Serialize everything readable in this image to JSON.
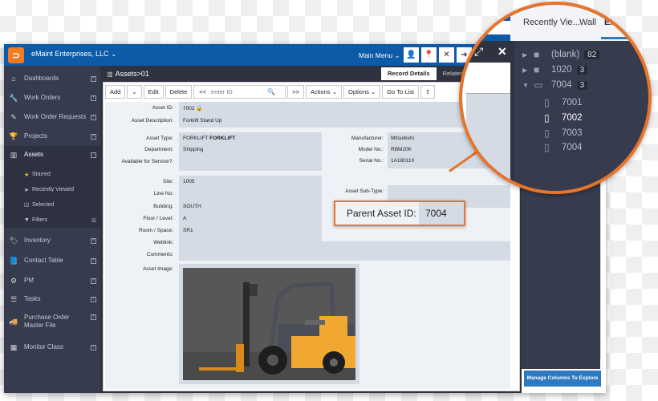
{
  "app": {
    "company": "eMaint Enterprises, LLC",
    "main_menu": "Main Menu",
    "toolbar_icons": [
      "user-icon",
      "pin-icon",
      "close-x-icon",
      "logout-icon"
    ]
  },
  "sidebar": {
    "items": [
      {
        "label": "Dashboards",
        "icon": "home-icon"
      },
      {
        "label": "Work Orders",
        "icon": "wrench-icon"
      },
      {
        "label": "Work Order Requests",
        "icon": "edit-icon"
      },
      {
        "label": "Projects",
        "icon": "trophy-icon"
      },
      {
        "label": "Assets",
        "icon": "barcode-icon"
      },
      {
        "label": "Inventory",
        "icon": "tag-icon"
      },
      {
        "label": "Contact Table",
        "icon": "book-icon"
      },
      {
        "label": "PM",
        "icon": "gears-icon"
      },
      {
        "label": "Tasks",
        "icon": "tasks-icon"
      },
      {
        "label": "Purchase Order Master File",
        "icon": "truck-icon"
      },
      {
        "label": "Monitor Class",
        "icon": "calendar-icon"
      }
    ],
    "asset_subitems": [
      {
        "label": "Starred",
        "icon": "star-icon"
      },
      {
        "label": "Recently Viewed",
        "icon": "location-arrow-icon"
      },
      {
        "label": "Selected",
        "icon": "checkbox-icon"
      },
      {
        "label": "Filters",
        "icon": "filter-icon"
      }
    ]
  },
  "content": {
    "breadcrumb": "Assets>01",
    "tabs": [
      "Record Details",
      "Related Ta"
    ],
    "toolbar": {
      "add": "Add",
      "edit": "Edit",
      "delete": "Delete",
      "prev": "<<",
      "search_placeholder": "enter ID",
      "next": ">>",
      "actions": "Actions",
      "options": "Options",
      "go_to_list": "Go To List"
    },
    "fields": {
      "asset_id_label": "Asset ID:",
      "asset_id": "7002",
      "asset_description_label": "Asset Description:",
      "asset_description": "Forklift Stand Up",
      "asset_type_label": "Asset Type:",
      "asset_type_code": "FORKLIFT",
      "asset_type_name": "FORKLIFT",
      "department_label": "Department:",
      "department": "Shipping",
      "available_label": "Available for Service?:",
      "manufacturer_label": "Manufacturer:",
      "manufacturer": "Mitsubishi",
      "model_label": "Model No.:",
      "model": "RBM20K",
      "serial_label": "Serial No.:",
      "serial": "1A180110",
      "site_label": "Site:",
      "site": "1005",
      "line_label": "Line No:",
      "building_label": "Building:",
      "building": "SOUTH",
      "floor_label": "Floor / Level:",
      "floor": "A",
      "room_label": "Room / Space:",
      "room": "SR1",
      "weblink_label": "Weblink:",
      "comments_label": "Comments:",
      "subtype_label": "Asset Sub-Type:",
      "image_label": "Asset Image:"
    },
    "callout": {
      "label": "Parent Asset ID:",
      "value": "7004"
    }
  },
  "explore": {
    "tabs": [
      "Recently Vie...",
      "Wall",
      "Exp"
    ],
    "tree": [
      {
        "label": "(blank)",
        "count": "82",
        "expanded": false
      },
      {
        "label": "1020",
        "count": "3",
        "expanded": false
      },
      {
        "label": "7004",
        "count": "3",
        "expanded": true
      }
    ],
    "leaves": [
      "7001",
      "7002",
      "7003",
      "7004"
    ],
    "selected_leaf": "7002",
    "manage_button": "Manage Columns To Explore"
  },
  "colors": {
    "brand_blue": "#0d5aa7",
    "accent_orange": "#e8742a",
    "sidebar_bg": "#363b4e"
  }
}
